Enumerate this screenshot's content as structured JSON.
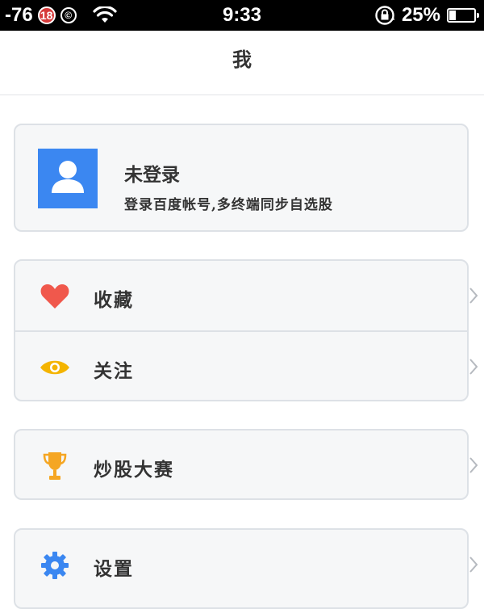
{
  "status_bar": {
    "signal": "-76",
    "badge": "18",
    "copyright": "©",
    "time": "9:33",
    "battery_percent_text": "25%",
    "battery_level": 0.25
  },
  "header": {
    "title": "我"
  },
  "profile": {
    "title": "未登录",
    "subtitle": "登录百度帐号,多终端同步自选股",
    "avatar_color": "#3b87f1"
  },
  "menu": {
    "favorites": {
      "label": "收藏",
      "icon": "heart-icon",
      "color": "#f0584c"
    },
    "follow": {
      "label": "关注",
      "icon": "eye-icon",
      "color": "#f4b400"
    },
    "contest": {
      "label": "炒股大赛",
      "icon": "trophy-icon",
      "color": "#f5a623"
    },
    "settings": {
      "label": "设置",
      "icon": "gear-icon",
      "color": "#3b87f1"
    }
  }
}
